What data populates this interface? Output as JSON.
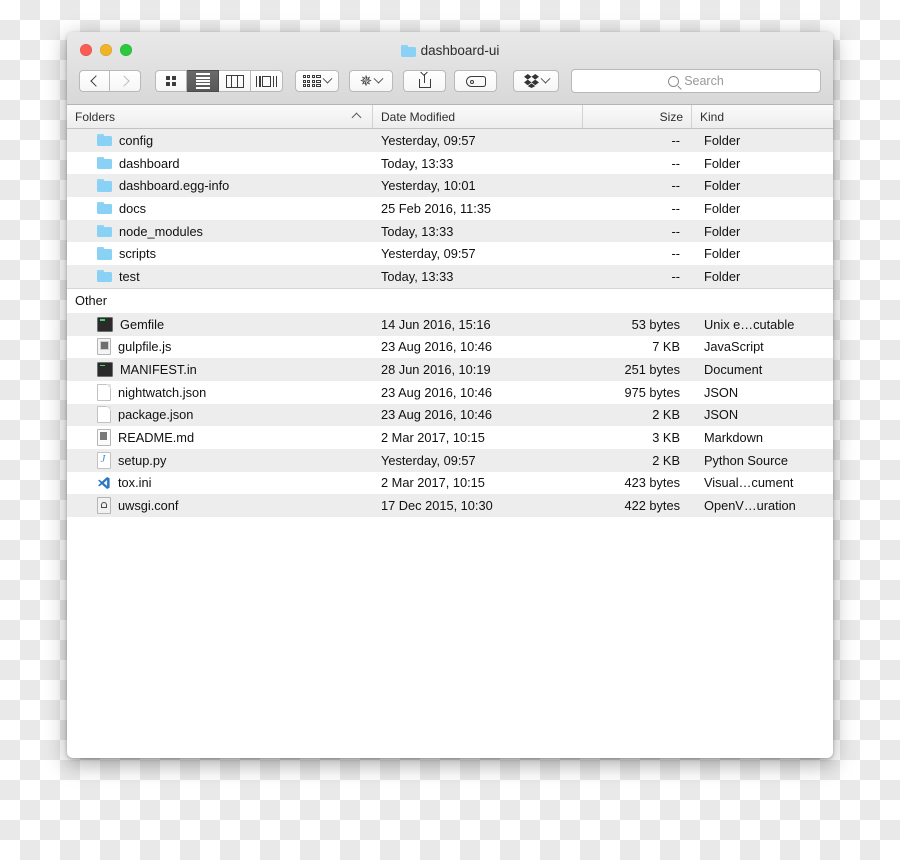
{
  "window": {
    "title": "dashboard-ui",
    "title_icon": "folder-icon",
    "traffic_lights": [
      {
        "name": "close-button",
        "color": "#fc5c54"
      },
      {
        "name": "minimize-button",
        "color": "#f0b429"
      },
      {
        "name": "zoom-button",
        "color": "#2bc940"
      }
    ]
  },
  "toolbar": {
    "back_icon": "chevron-left-icon",
    "forward_icon": "chevron-right-icon",
    "view_modes": [
      {
        "name": "icon-view-button",
        "icon": "grid-icon",
        "active": false
      },
      {
        "name": "list-view-button",
        "icon": "list-icon",
        "active": true
      },
      {
        "name": "column-view-button",
        "icon": "columns-icon",
        "active": false
      },
      {
        "name": "gallery-view-button",
        "icon": "gallery-icon",
        "active": false
      }
    ],
    "arrange_icon": "arrange-icon",
    "action_icon": "gear-icon",
    "share_icon": "share-icon",
    "tag_icon": "tag-icon",
    "dropbox_icon": "dropbox-icon",
    "chevron_icon": "chevron-down-icon"
  },
  "search": {
    "placeholder": "Search",
    "value": "",
    "icon": "search-icon"
  },
  "columns": {
    "name": "Folders",
    "date": "Date Modified",
    "size": "Size",
    "kind": "Kind",
    "sort_direction": "ascending",
    "sort_icon": "chevron-up-icon"
  },
  "groups": [
    {
      "header": null,
      "rows": [
        {
          "icon": "folder-icon",
          "icon_type": "folder",
          "name": "config",
          "date": "Yesterday, 09:57",
          "size": "--",
          "kind": "Folder"
        },
        {
          "icon": "folder-icon",
          "icon_type": "folder",
          "name": "dashboard",
          "date": "Today, 13:33",
          "size": "--",
          "kind": "Folder"
        },
        {
          "icon": "folder-icon",
          "icon_type": "folder",
          "name": "dashboard.egg-info",
          "date": "Yesterday, 10:01",
          "size": "--",
          "kind": "Folder"
        },
        {
          "icon": "folder-icon",
          "icon_type": "folder",
          "name": "docs",
          "date": "25 Feb 2016, 11:35",
          "size": "--",
          "kind": "Folder"
        },
        {
          "icon": "folder-icon",
          "icon_type": "folder",
          "name": "node_modules",
          "date": "Today, 13:33",
          "size": "--",
          "kind": "Folder"
        },
        {
          "icon": "folder-icon",
          "icon_type": "folder",
          "name": "scripts",
          "date": "Yesterday, 09:57",
          "size": "--",
          "kind": "Folder"
        },
        {
          "icon": "folder-icon",
          "icon_type": "folder",
          "name": "test",
          "date": "Today, 13:33",
          "size": "--",
          "kind": "Folder"
        }
      ]
    },
    {
      "header": "Other",
      "rows": [
        {
          "icon": "terminal-file-icon",
          "icon_type": "term",
          "name": "Gemfile",
          "date": "14 Jun 2016, 15:16",
          "size": "53 bytes",
          "kind": "Unix e…cutable"
        },
        {
          "icon": "preview-file-icon",
          "icon_type": "preview",
          "name": "gulpfile.js",
          "date": "23 Aug 2016, 10:46",
          "size": "7 KB",
          "kind": "JavaScript"
        },
        {
          "icon": "terminal-file-icon",
          "icon_type": "term",
          "name": "MANIFEST.in",
          "date": "28 Jun 2016, 10:19",
          "size": "251 bytes",
          "kind": "Document"
        },
        {
          "icon": "blank-document-icon",
          "icon_type": "doc",
          "name": "nightwatch.json",
          "date": "23 Aug 2016, 10:46",
          "size": "975 bytes",
          "kind": "JSON"
        },
        {
          "icon": "blank-document-icon",
          "icon_type": "doc",
          "name": "package.json",
          "date": "23 Aug 2016, 10:46",
          "size": "2 KB",
          "kind": "JSON"
        },
        {
          "icon": "markdown-file-icon",
          "icon_type": "md",
          "name": "README.md",
          "date": "2 Mar 2017, 10:15",
          "size": "3 KB",
          "kind": "Markdown"
        },
        {
          "icon": "python-file-icon",
          "icon_type": "py",
          "name": "setup.py",
          "date": "Yesterday, 09:57",
          "size": "2 KB",
          "kind": "Python Source"
        },
        {
          "icon": "vscode-file-icon",
          "icon_type": "code",
          "name": "tox.ini",
          "date": "2 Mar 2017, 10:15",
          "size": "423 bytes",
          "kind": "Visual…cument"
        },
        {
          "icon": "config-file-icon",
          "icon_type": "conf",
          "name": "uwsgi.conf",
          "date": "17 Dec 2015, 10:30",
          "size": "422 bytes",
          "kind": "OpenV…uration"
        }
      ]
    }
  ]
}
